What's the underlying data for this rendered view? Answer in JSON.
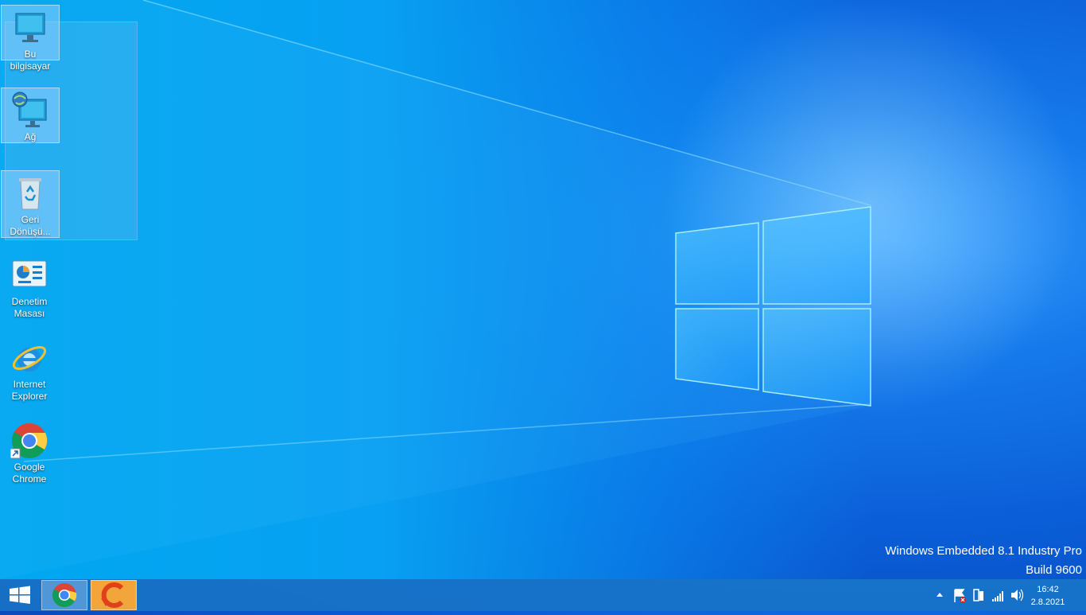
{
  "desktop": {
    "icons": [
      {
        "label": "Bu bilgisayar",
        "icon": "computer-icon",
        "selected": true
      },
      {
        "label": "Ağ",
        "icon": "network-icon",
        "selected": true
      },
      {
        "label": "Geri Dönüşü...",
        "icon": "recycle-bin-icon",
        "selected": true
      },
      {
        "label": "Denetim Masası",
        "icon": "control-panel-icon",
        "selected": false
      },
      {
        "label": "Internet Explorer",
        "icon": "internet-explorer-icon",
        "selected": false
      },
      {
        "label": "Google Chrome",
        "icon": "chrome-icon",
        "selected": false
      }
    ],
    "watermark": {
      "line1": "Windows Embedded 8.1 Industry Pro",
      "line2": "Build 9600"
    }
  },
  "taskbar": {
    "pinned": [
      {
        "name": "Google Chrome",
        "icon": "chrome-icon",
        "active": true
      },
      {
        "name": "CCleaner",
        "icon": "ccleaner-icon",
        "active": false
      }
    ],
    "tray": {
      "icons": [
        "show-hidden-icons-icon",
        "action-center-flag-icon",
        "usb-device-icon",
        "signal-icon",
        "volume-icon"
      ]
    },
    "clock": {
      "time": "16:42",
      "date": "2.8.2021"
    }
  },
  "colors": {
    "accent": "#1679ea",
    "taskbar": "#1978c8",
    "ccleaner": "#f2a53a"
  }
}
